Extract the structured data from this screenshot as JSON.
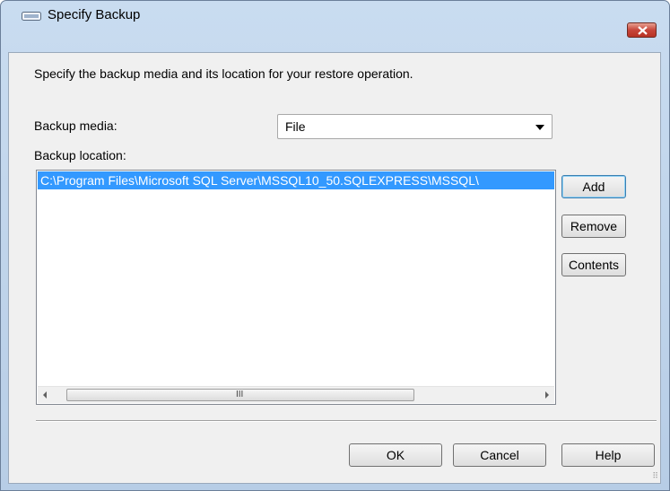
{
  "window": {
    "title": "Specify Backup"
  },
  "dialog": {
    "instruction": "Specify the backup media and its location for your restore operation.",
    "backup_media_label": "Backup media:",
    "backup_media_value": "File",
    "backup_location_label": "Backup location:",
    "locations": [
      "C:\\Program Files\\Microsoft SQL Server\\MSSQL10_50.SQLEXPRESS\\MSSQL\\"
    ],
    "scroll_grip": "III"
  },
  "buttons": {
    "add": "Add",
    "remove": "Remove",
    "contents": "Contents",
    "ok": "OK",
    "cancel": "Cancel",
    "help": "Help"
  },
  "colors": {
    "selection": "#3399ff",
    "close_button": "#c7453a"
  },
  "icons": {
    "title": "window-icon",
    "close": "close-icon"
  }
}
